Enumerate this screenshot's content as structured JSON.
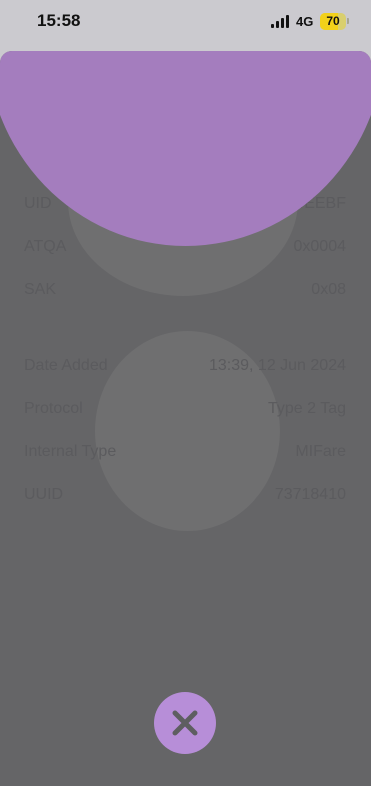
{
  "status_bar": {
    "time": "15:58",
    "network": "4G",
    "battery": "70",
    "battery_level": 0.7
  },
  "tag_info": {
    "uid": {
      "label": "UID",
      "value": "…EEBF"
    },
    "atqa": {
      "label": "ATQA",
      "value": "0x0004"
    },
    "sak": {
      "label": "SAK",
      "value": "0x08"
    },
    "date_added": {
      "label": "Date Added",
      "value": "13:39, 12 Jun 2024"
    },
    "protocol": {
      "label": "Protocol",
      "value": "Type 2 Tag"
    },
    "internal_type": {
      "label": "Internal Type",
      "value": "MIFare"
    },
    "uuid": {
      "label": "UUID",
      "value": "73718410"
    }
  },
  "close_button": {
    "icon": "close-icon"
  },
  "colors": {
    "accent": "#b78ed8",
    "overlay_circle": "#a47dbe",
    "sheet": "#656567",
    "status_bar": "#cbcacf"
  }
}
